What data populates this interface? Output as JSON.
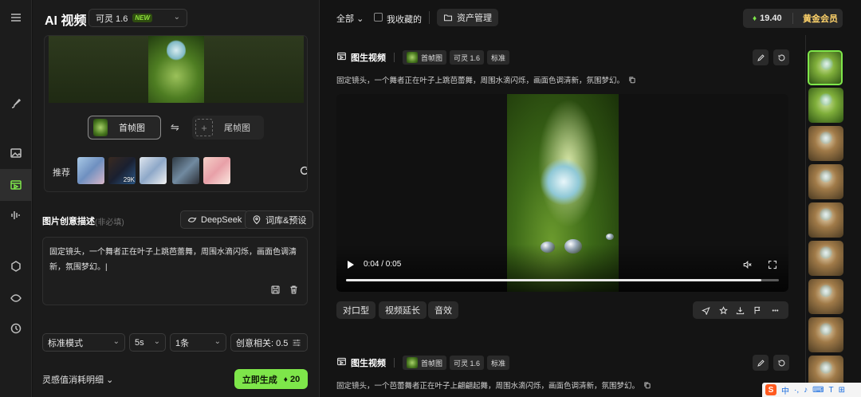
{
  "app": {
    "title": "AI 视频",
    "model": "可灵 1.6",
    "model_badge": "NEW"
  },
  "left_panel": {
    "first_frame_label": "首帧图",
    "last_frame_label": "尾帧图",
    "recommend_label": "推荐",
    "recommend_badge": "29K",
    "description_title": "图片创意描述",
    "description_optional": "(非必填)",
    "deepseek_label": "DeepSeek",
    "preset_label": "词库&预设",
    "description_text": "固定镜头，一个舞者正在叶子上跳芭蕾舞，周围水滴闪烁，画面色调清新，氛围梦幻。|",
    "mode_select": "标准模式",
    "duration_select": "5s",
    "count_select": "1条",
    "creativity_label": "创意相关: 0.5",
    "detail_label": "灵感值消耗明细",
    "generate_label": "立即生成",
    "generate_cost": "20"
  },
  "topbar": {
    "filter_all": "全部",
    "favorites_label": "我收藏的",
    "asset_label": "资产管理",
    "credits": "19.40",
    "vip_label": "黄金会员"
  },
  "cards": [
    {
      "type_label": "图生视频",
      "tag_first_frame": "首帧图",
      "tag_model": "可灵 1.6",
      "tag_mode": "标准",
      "prompt": "固定镜头，一个舞者正在叶子上跳芭蕾舞，周围水滴闪烁，画面色调清新，氛围梦幻。",
      "video_time": "0:04 / 0:05",
      "progress": 0.96,
      "actions": [
        "对口型",
        "视频延长",
        "音效"
      ]
    },
    {
      "type_label": "图生视频",
      "tag_first_frame": "首帧图",
      "tag_model": "可灵 1.6",
      "tag_mode": "标准",
      "prompt": "固定镜头，一个芭蕾舞者正在叶子上翩翩起舞，周围水滴闪烁，画面色调清新，氛围梦幻。"
    }
  ],
  "ime": {
    "lang": "中"
  },
  "colors": {
    "accent_green": "#7ee64a",
    "vip_gold": "#ffd36a",
    "background": "#141414"
  }
}
